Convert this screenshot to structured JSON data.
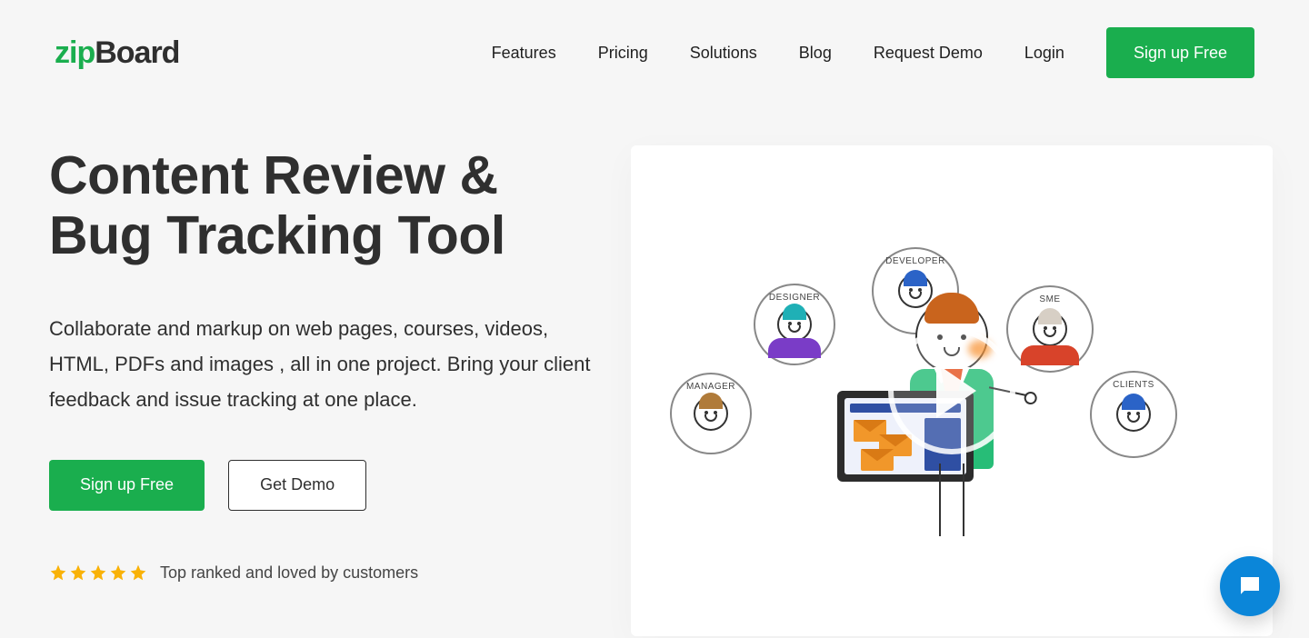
{
  "brand": {
    "part1": "zip",
    "part2": "Board"
  },
  "nav": {
    "items": [
      {
        "label": "Features"
      },
      {
        "label": "Pricing"
      },
      {
        "label": "Solutions"
      },
      {
        "label": "Blog"
      },
      {
        "label": "Request Demo"
      },
      {
        "label": "Login"
      }
    ],
    "cta": "Sign up Free"
  },
  "hero": {
    "title_line1": "Content Review &",
    "title_line2": "Bug Tracking Tool",
    "subtitle": "Collaborate and markup on web pages, courses, videos, HTML, PDFs and images , all in one project. Bring your client feedback and issue tracking at one place.",
    "primary_cta": "Sign up Free",
    "secondary_cta": "Get Demo",
    "rating_text": "Top ranked and loved by customers",
    "rating_value": 5
  },
  "roles": {
    "manager": "MANAGER",
    "designer": "DESIGNER",
    "developer": "DEVELOPER",
    "sme": "SME",
    "clients": "CLIENTS"
  },
  "colors": {
    "accent": "#1aae4e",
    "text": "#2f2f2f",
    "star": "#f9b207",
    "chat": "#0b86d9"
  }
}
